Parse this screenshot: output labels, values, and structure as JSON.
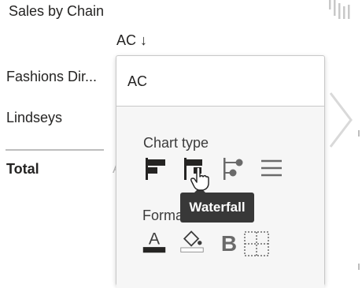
{
  "visual": {
    "title": "Sales by Chain",
    "column_header": "AC ↓",
    "rows": [
      {
        "label": "Fashions Dir..."
      },
      {
        "label": "Lindseys"
      }
    ],
    "total_label": "Total",
    "ghost_letter": "A",
    "menu_icon": "more-options-icon",
    "nav_icon": "chevron-right-icon"
  },
  "popup": {
    "search_value": "AC",
    "chart_type_label": "Chart type",
    "format_column_label": "Format column",
    "chart_types": [
      "bar-chart-icon",
      "waterfall-chart-icon",
      "lollipop-chart-icon",
      "list-icon"
    ],
    "format_tools": [
      "font-color-icon",
      "fill-color-icon",
      "bold-icon",
      "borders-icon"
    ]
  },
  "tooltip": {
    "text": "Waterfall"
  },
  "colors": {
    "accent_dark": "#252423",
    "icon_gray": "#6a6a6a",
    "tooltip_bg": "#383838",
    "panel_bg": "#f6f6f6"
  }
}
